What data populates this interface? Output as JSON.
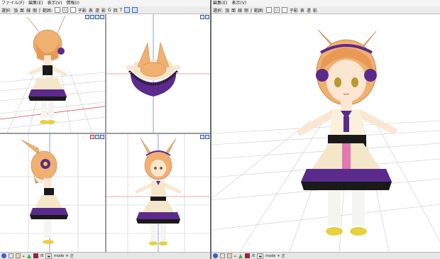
{
  "left_window": {
    "menu": [
      "ファイル(F)",
      "編集(E)",
      "表示(V)",
      "情報(I)"
    ],
    "toolbar": {
      "select_label": "選択:",
      "select_items": [
        "頂",
        "面",
        "線",
        "剛",
        "J"
      ],
      "range_label": "範囲:",
      "tools": [
        "子影",
        "表",
        "遠",
        "影",
        "G",
        "回",
        "T"
      ]
    },
    "status": {
      "grid": "▴",
      "deg": "⬓",
      "num": "/E",
      "mode_label": "mode",
      "mode_value": "▾",
      "extra": "正"
    }
  },
  "right_window": {
    "menu": [
      "編集(E)",
      "表示(V)"
    ],
    "toolbar": {
      "select_label": "選択:",
      "select_items": [
        "頂",
        "面",
        "線",
        "剛",
        "J"
      ],
      "range_label": "範囲:",
      "tools": [
        "子影",
        "表",
        "遠",
        "影"
      ]
    },
    "status": {
      "grid": "▴",
      "deg": "⬓",
      "num": "/E",
      "mode_label": "mode",
      "mode_value": "▾",
      "extra": "正"
    }
  },
  "colors": {
    "hair": "#f0b070",
    "hair_dark": "#c8783c",
    "skin": "#fbe6d2",
    "dress": "#f4e6c8",
    "purple": "#5a2a8c",
    "black": "#1a1a1a",
    "grid": "#c8c8c8",
    "axis_red": "#e05050",
    "axis_blue": "#3c5ad8"
  }
}
